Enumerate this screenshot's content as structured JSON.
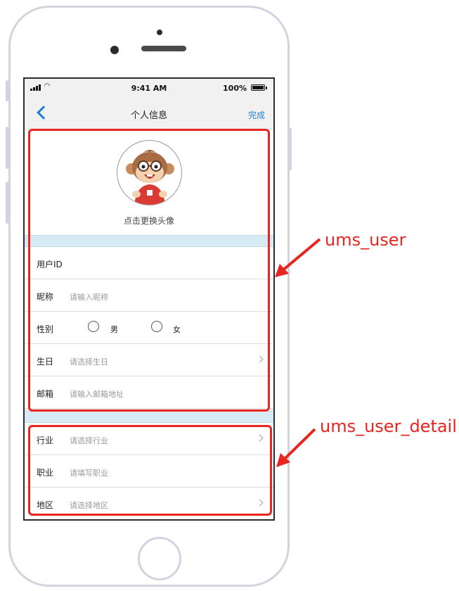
{
  "status_bar": {
    "time": "9:41 AM",
    "battery": "100%"
  },
  "nav": {
    "title": "个人信息",
    "done_label": "完成"
  },
  "avatar": {
    "caption": "点击更换头像"
  },
  "user_fields": [
    {
      "label": "用户ID",
      "placeholder": ""
    },
    {
      "label": "昵称",
      "placeholder": "请输入昵称"
    },
    {
      "label": "性别",
      "placeholder": ""
    },
    {
      "label": "生日",
      "placeholder": "请选择生日"
    },
    {
      "label": "邮箱",
      "placeholder": "请输入邮箱地址"
    }
  ],
  "gender": {
    "male": "男",
    "female": "女"
  },
  "detail_fields": [
    {
      "label": "行业",
      "placeholder": "请选择行业"
    },
    {
      "label": "职业",
      "placeholder": "请填写职业"
    },
    {
      "label": "地区",
      "placeholder": "请选择地区"
    }
  ],
  "annotations": {
    "user_table": "ums_user",
    "detail_table": "ums_user_detail"
  },
  "colors": {
    "accent": "#1f7fd6",
    "annotation": "#e8251f",
    "separator": "#d7ebf5"
  }
}
